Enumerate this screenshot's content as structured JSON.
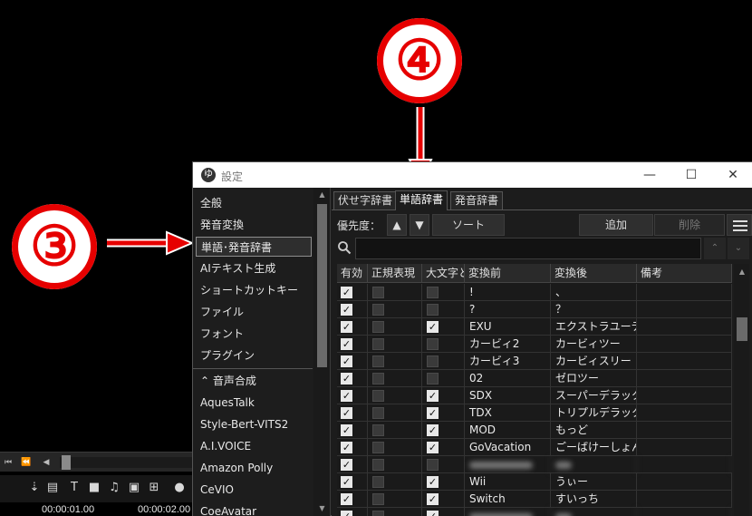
{
  "annotations": {
    "step_top": "④",
    "step_left": "③"
  },
  "background": {
    "time_left": "00:00:01.00",
    "time_right": "00:00:02.00",
    "toolbar_icons": [
      "comment-icon",
      "text-icon",
      "video-icon",
      "music-icon",
      "image-icon",
      "add-layer-icon",
      "person-icon"
    ]
  },
  "window": {
    "title": "設定",
    "icon_text": "ゆ",
    "controls": {
      "minimize": "—",
      "maximize": "☐",
      "close": "✕"
    }
  },
  "sidebar": {
    "items": [
      {
        "label": "全般"
      },
      {
        "label": "発音変換"
      },
      {
        "label": "単語･発音辞書",
        "selected": true
      },
      {
        "label": "AIテキスト生成"
      },
      {
        "label": "ショートカットキー"
      },
      {
        "label": "ファイル"
      },
      {
        "label": "フォント"
      },
      {
        "label": "プラグイン"
      }
    ],
    "group_header": "⌃  音声合成",
    "voice_items": [
      {
        "label": "AquesTalk"
      },
      {
        "label": "Style-Bert-VITS2"
      },
      {
        "label": "A.I.VOICE"
      },
      {
        "label": "Amazon Polly"
      },
      {
        "label": "CeVIO"
      },
      {
        "label": "CoeAvatar"
      }
    ]
  },
  "tabs": [
    {
      "label": "伏せ字辞書",
      "active": false
    },
    {
      "label": "単語辞書",
      "active": true
    },
    {
      "label": "発音辞書",
      "active": false
    }
  ],
  "toolbar": {
    "priority_label": "優先度：",
    "up_label": "▲",
    "down_label": "▼",
    "sort_label": "ソート",
    "add_label": "追加",
    "delete_label": "削除"
  },
  "search": {
    "value": "",
    "placeholder": "",
    "prev": "⌃",
    "next": "⌄"
  },
  "table": {
    "columns": [
      "有効",
      "正規表現",
      "大文字と",
      "変換前",
      "変換後",
      "備考"
    ],
    "rows": [
      {
        "enabled": true,
        "regex": false,
        "case": false,
        "before": "!",
        "after": "、",
        "note": ""
      },
      {
        "enabled": true,
        "regex": false,
        "case": false,
        "before": "?",
        "after": "？",
        "note": ""
      },
      {
        "enabled": true,
        "regex": false,
        "case": true,
        "before": "EXU",
        "after": "エクストラユーティリティ",
        "note": ""
      },
      {
        "enabled": true,
        "regex": false,
        "case": false,
        "before": "カービィ2",
        "after": "カービィツー",
        "note": ""
      },
      {
        "enabled": true,
        "regex": false,
        "case": false,
        "before": "カービィ3",
        "after": "カービィスリー",
        "note": ""
      },
      {
        "enabled": true,
        "regex": false,
        "case": false,
        "before": "02",
        "after": "ゼロツー",
        "note": ""
      },
      {
        "enabled": true,
        "regex": false,
        "case": true,
        "before": "SDX",
        "after": "スーパーデラックス",
        "note": ""
      },
      {
        "enabled": true,
        "regex": false,
        "case": true,
        "before": "TDX",
        "after": "トリプルデラックス",
        "note": ""
      },
      {
        "enabled": true,
        "regex": false,
        "case": true,
        "before": "MOD",
        "after": "もっど",
        "note": ""
      },
      {
        "enabled": true,
        "regex": false,
        "case": true,
        "before": "GoVacation",
        "after": "ごーばけーしょん",
        "note": ""
      },
      {
        "enabled": true,
        "regex": false,
        "case": false,
        "before": "",
        "after": "",
        "note": "",
        "blurred": true
      },
      {
        "enabled": true,
        "regex": false,
        "case": true,
        "before": "Wii",
        "after": "うぃー",
        "note": ""
      },
      {
        "enabled": true,
        "regex": false,
        "case": true,
        "before": "Switch",
        "after": "すいっち",
        "note": ""
      },
      {
        "enabled": true,
        "regex": false,
        "case": true,
        "before": "",
        "after": "",
        "note": "",
        "blurred": true
      }
    ]
  }
}
